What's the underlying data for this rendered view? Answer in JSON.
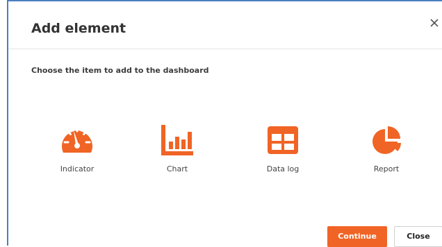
{
  "dialog": {
    "title": "Add element",
    "instruction": "Choose the item to add to the dashboard",
    "close_icon": "close-icon"
  },
  "items": [
    {
      "label": "Indicator",
      "icon": "gauge-icon"
    },
    {
      "label": "Chart",
      "icon": "bar-chart-icon"
    },
    {
      "label": "Data log",
      "icon": "table-icon"
    },
    {
      "label": "Report",
      "icon": "pie-chart-icon"
    }
  ],
  "buttons": {
    "continue_label": "Continue",
    "close_label": "Close"
  },
  "colors": {
    "accent": "#f06425",
    "border": "#4a7fc1"
  }
}
